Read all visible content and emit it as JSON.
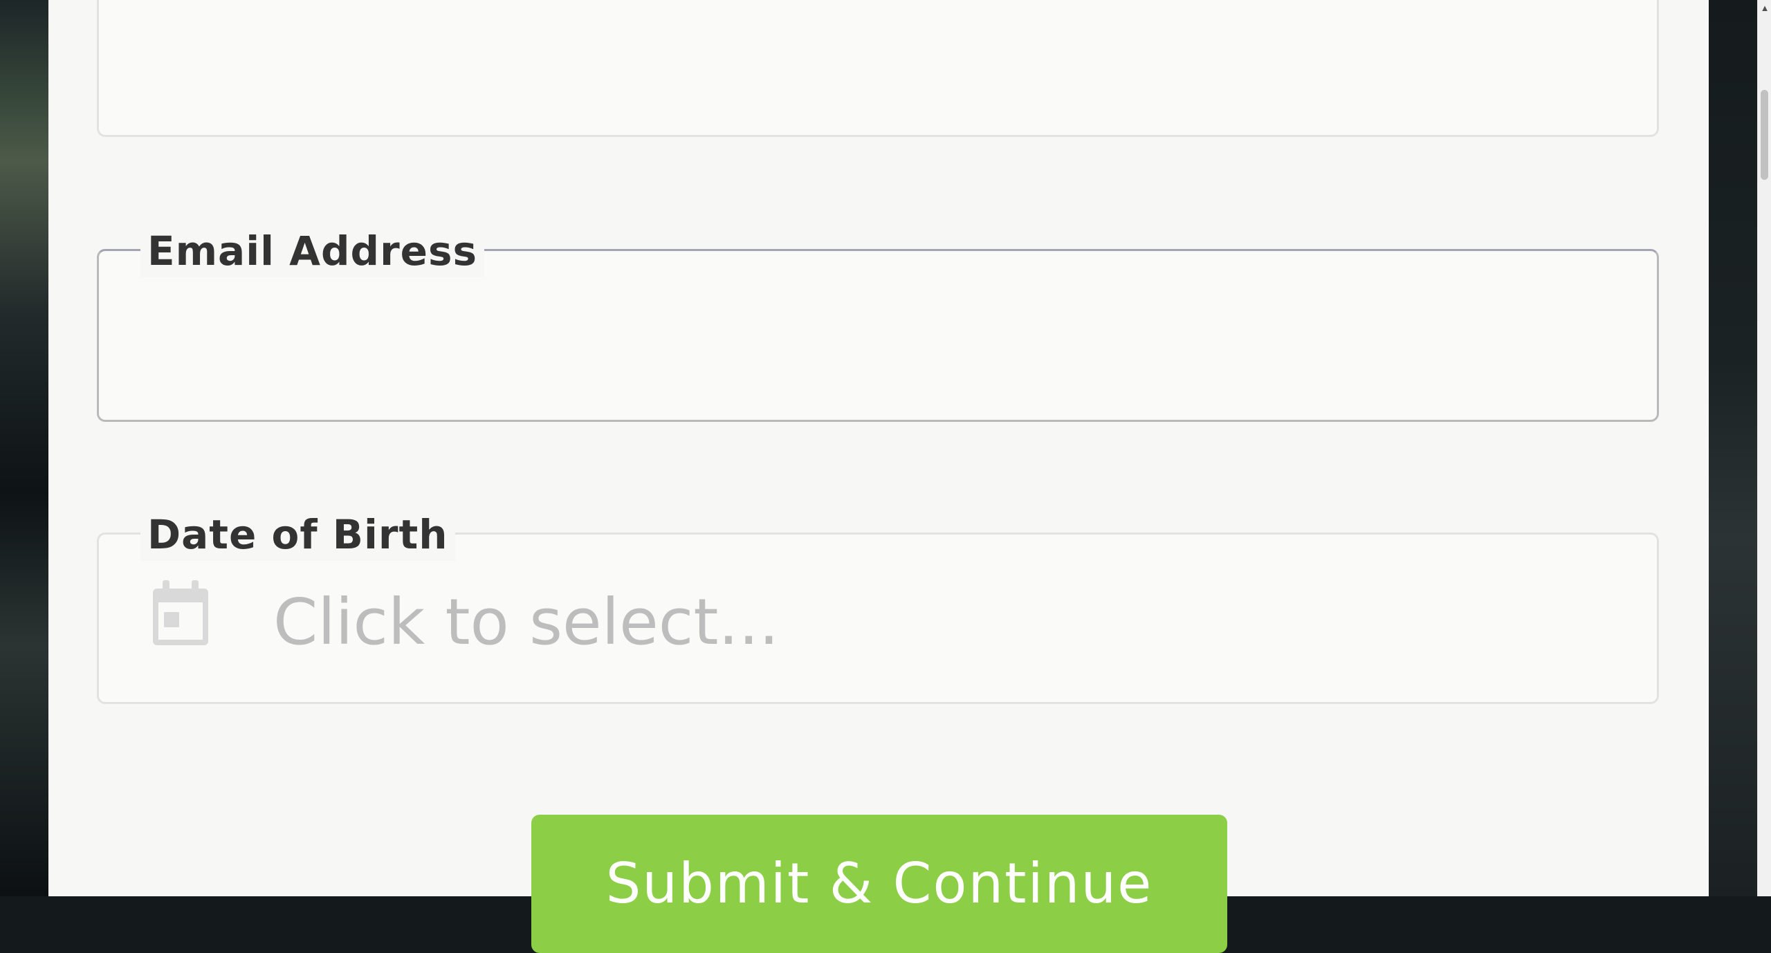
{
  "form": {
    "email": {
      "label": "Email Address",
      "value": ""
    },
    "dob": {
      "label": "Date of Birth",
      "placeholder": "Click to select..."
    },
    "submit_label": "Submit & Continue"
  },
  "scrollbar": {
    "up_arrow": "▲"
  },
  "icons": {
    "calendar": "calendar-icon"
  },
  "colors": {
    "submit_button": "#8ccf47",
    "placeholder": "#bdbdbd",
    "label": "#333333"
  }
}
